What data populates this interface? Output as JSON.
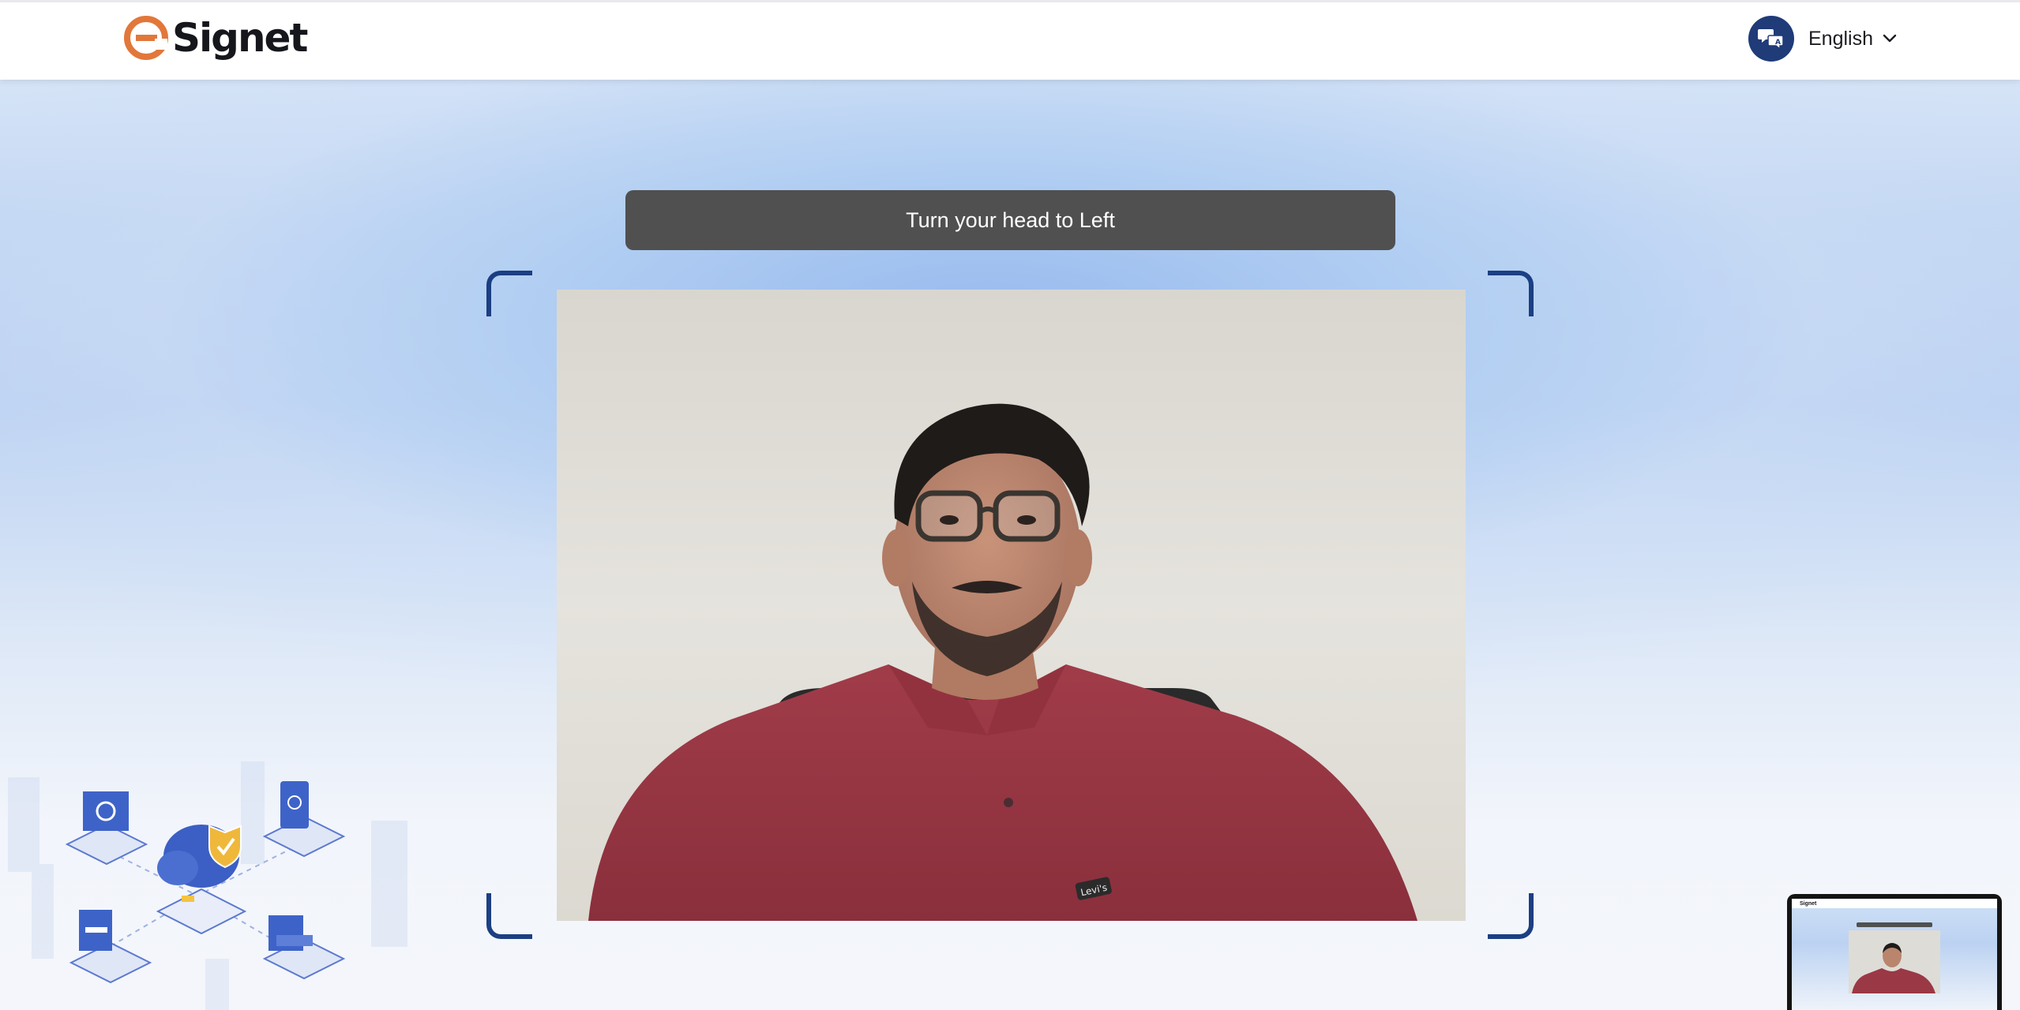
{
  "header": {
    "logo_text": "Signet",
    "language": {
      "selected": "English",
      "icon": "language-chat-icon",
      "chevron_icon": "chevron-down-icon"
    }
  },
  "instruction": {
    "text": "Turn your head to Left"
  },
  "camera": {
    "subject_shirt_logo": "Levi's"
  },
  "thumbnail": {
    "logo_text": "Signet"
  },
  "colors": {
    "brand_orange": "#e2773a",
    "frame_blue": "#1b3f83",
    "banner_bg": "#505050",
    "language_icon_bg": "#1f3b78"
  }
}
